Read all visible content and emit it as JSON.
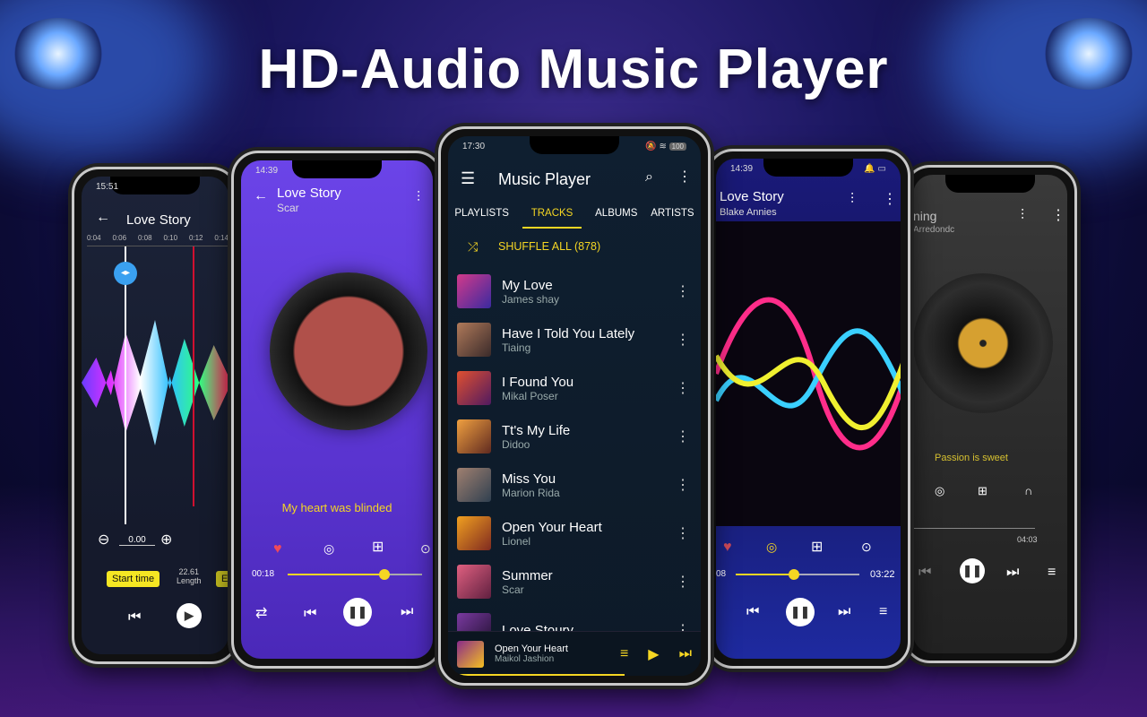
{
  "headline": "HD-Audio Music Player",
  "colors": {
    "accent": "#f5d623",
    "center_bg": "#0f1e30",
    "purple_bg": "#6a3fe0",
    "blue_bg": "#1b1f8a"
  },
  "phone_cutter": {
    "time": "15:51",
    "title": "Love Story",
    "ticks": [
      "0:04",
      "0:06",
      "0:08",
      "0:10",
      "0:12",
      "0:14"
    ],
    "value": "0.00",
    "start_label": "Start time",
    "length_value": "22.61",
    "length_label": "Length",
    "end_label": "E"
  },
  "phone_purple": {
    "time": "14:39",
    "title": "Love Story",
    "artist": "Scar",
    "lyric": "My heart was blinded",
    "elapsed": "00:18",
    "progress": 0.72
  },
  "phone_center": {
    "time": "17:30",
    "battery": "100",
    "app_title": "Music Player",
    "tabs": [
      "PLAYLISTS",
      "TRACKS",
      "ALBUMS",
      "ARTISTS"
    ],
    "active_tab": "TRACKS",
    "shuffle": "SHUFFLE ALL (878)",
    "tracks": [
      {
        "title": "My Love",
        "artist": "James shay"
      },
      {
        "title": "Have I Told You Lately",
        "artist": "Tiaing"
      },
      {
        "title": "I Found You",
        "artist": "Mikal Poser"
      },
      {
        "title": "Tt's My Life",
        "artist": "Didoo"
      },
      {
        "title": "Miss You",
        "artist": "Marion Rida"
      },
      {
        "title": "Open Your Heart",
        "artist": "Lionel"
      },
      {
        "title": "Summer",
        "artist": "Scar"
      },
      {
        "title": "Love Stoury",
        "artist": ""
      }
    ],
    "now_playing": {
      "title": "Open Your Heart",
      "artist": "Maikol Jashion"
    }
  },
  "phone_blue": {
    "time": "14:39",
    "title": "Love Story",
    "artist": "Blake Annies",
    "elapsed": "08",
    "total": "03:22",
    "progress": 0.47
  },
  "phone_gray": {
    "title": "ning",
    "artist": "Arredondc",
    "lyric": "Passion is sweet",
    "total": "04:03"
  }
}
